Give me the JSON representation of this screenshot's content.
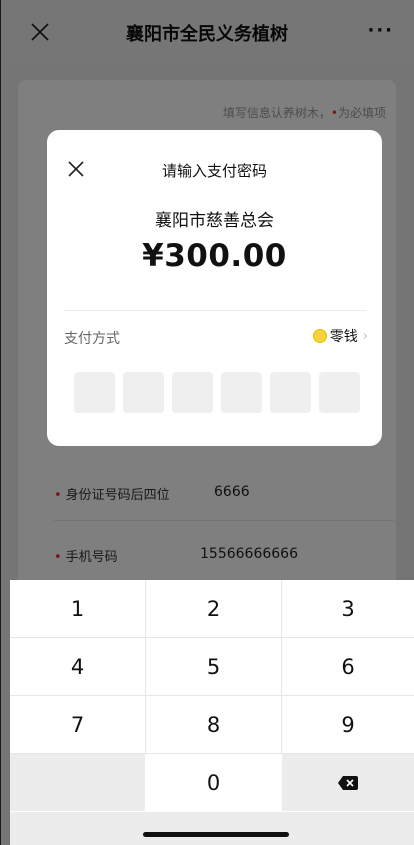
{
  "navbar": {
    "title": "襄阳市全民义务植树",
    "more": "···",
    "close_icon": "close-icon"
  },
  "form": {
    "hint": "填写信息认养树木，",
    "hint_required_mark": "•",
    "hint_required_text": "为必填项",
    "fields": [
      {
        "label": "身份证号码后四位",
        "value": "6666"
      },
      {
        "label": "手机号码",
        "value": "15566666666"
      }
    ]
  },
  "dialog": {
    "title": "请输入支付密码",
    "merchant": "襄阳市慈善总会",
    "amount": "¥300.00",
    "method_label": "支付方式",
    "method_value": "零钱",
    "method_chevron": "›",
    "pin_digits": 6
  },
  "keypad": {
    "keys": [
      "1",
      "2",
      "3",
      "4",
      "5",
      "6",
      "7",
      "8",
      "9",
      "0"
    ],
    "delete_icon": "backspace-icon"
  },
  "colors": {
    "accent_green": "#2e6b4a",
    "required_red": "#e33333",
    "coin_yellow": "#f7d43c"
  }
}
